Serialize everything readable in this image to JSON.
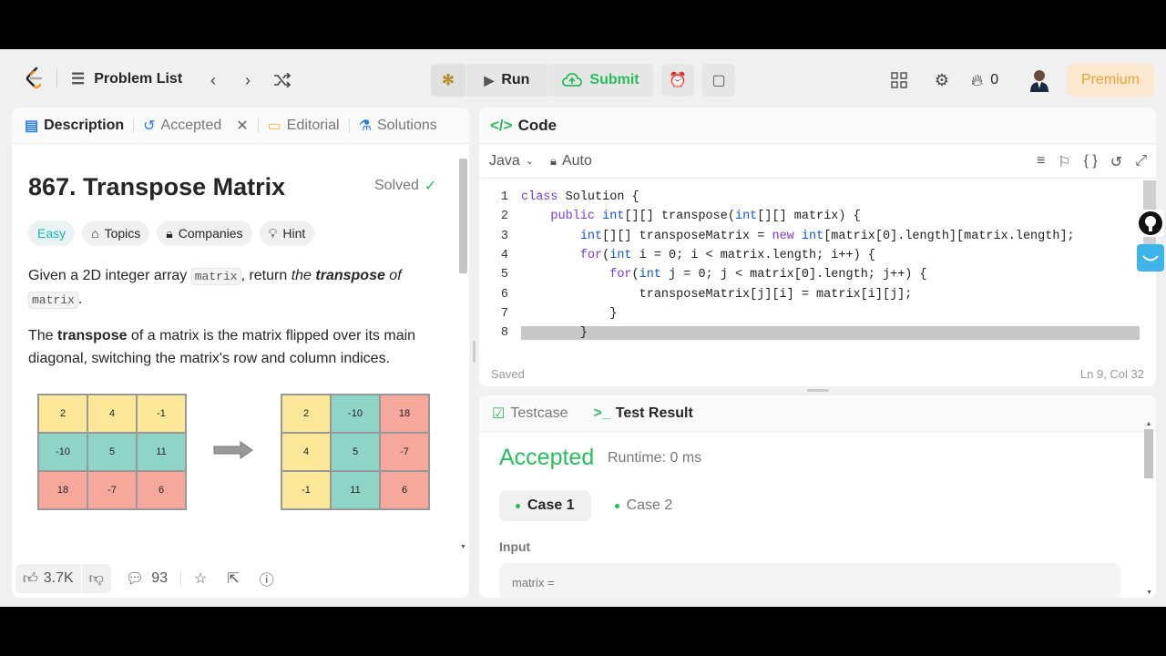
{
  "nav": {
    "problem_list": "Problem List",
    "run": "Run",
    "submit": "Submit",
    "streak": "0",
    "premium": "Premium"
  },
  "left_tabs": {
    "description": "Description",
    "accepted": "Accepted",
    "editorial": "Editorial",
    "solutions": "Solutions"
  },
  "problem": {
    "title": "867. Transpose Matrix",
    "status": "Solved",
    "difficulty": "Easy",
    "chip_topics": "Topics",
    "chip_companies": "Companies",
    "chip_hint": "Hint",
    "p1_a": "Given a 2D integer array ",
    "p1_code1": "matrix",
    "p1_b": ", return ",
    "p1_c": "the ",
    "p1_bold": "transpose",
    "p1_d": " of",
    "p1_code2": "matrix",
    "p1_e": ".",
    "p2_a": "The ",
    "p2_bold": "transpose",
    "p2_b": " of a matrix is the matrix flipped over its main diagonal, switching the matrix's row and column indices.",
    "matrix_before": [
      [
        "2",
        "4",
        "-1"
      ],
      [
        "-10",
        "5",
        "11"
      ],
      [
        "18",
        "-7",
        "6"
      ]
    ],
    "matrix_after": [
      [
        "2",
        "-10",
        "18"
      ],
      [
        "4",
        "5",
        "-7"
      ],
      [
        "-1",
        "11",
        "6"
      ]
    ]
  },
  "left_footer": {
    "likes": "3.7K",
    "comments": "93"
  },
  "code_panel": {
    "header": "Code",
    "language": "Java",
    "mode": "Auto",
    "saved": "Saved",
    "cursor": "Ln 9, Col 32",
    "lines": [
      "class Solution {",
      "    public int[][] transpose(int[][] matrix) {",
      "        int[][] transposeMatrix = new int[matrix[0].length][matrix.length];",
      "        for(int i = 0; i < matrix.length; i++) {",
      "            for(int j = 0; j < matrix[0].length; j++) {",
      "                transposeMatrix[j][i] = matrix[i][j];",
      "            }",
      "        }"
    ]
  },
  "result_panel": {
    "tab_testcase": "Testcase",
    "tab_result": "Test Result",
    "verdict": "Accepted",
    "runtime": "Runtime: 0 ms",
    "case1": "Case 1",
    "case2": "Case 2",
    "input_label": "Input",
    "input_value": "matrix ="
  }
}
